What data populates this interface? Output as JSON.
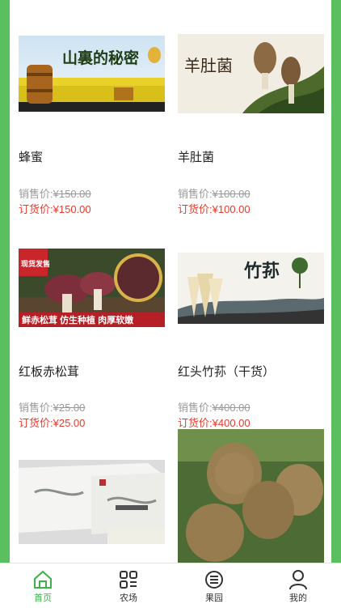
{
  "products": [
    {
      "name": "蜂蜜",
      "sale_label": "销售价:",
      "sale_price": "¥150.00",
      "order_label": "订货价:",
      "order_price": "¥150.00",
      "banner_text": "山裏的秘密"
    },
    {
      "name": "羊肚菌",
      "sale_label": "销售价:",
      "sale_price": "¥100.00",
      "order_label": "订货价:",
      "order_price": "¥100.00",
      "banner_text": "羊肚菌"
    },
    {
      "name": "红板赤松茸",
      "sale_label": "销售价:",
      "sale_price": "¥25.00",
      "order_label": "订货价:",
      "order_price": "¥25.00",
      "badge_text": "现货发售",
      "banner_text": "鲜赤松茸 仿生种植 肉厚软嫩"
    },
    {
      "name": "红头竹荪（干货）",
      "sale_label": "销售价:",
      "sale_price": "¥400.00",
      "order_label": "订货价:",
      "order_price": "¥400.00",
      "banner_text": "竹荪"
    }
  ],
  "tabbar": {
    "items": [
      {
        "label": "首页",
        "icon": "home-icon",
        "active": true
      },
      {
        "label": "农场",
        "icon": "grid-icon",
        "active": false
      },
      {
        "label": "果园",
        "icon": "list-circle-icon",
        "active": false
      },
      {
        "label": "我的",
        "icon": "user-icon",
        "active": false
      }
    ]
  },
  "colors": {
    "accent": "#3db14a",
    "price_red": "#e23b2e",
    "frame_green": "#5cbf5f"
  }
}
